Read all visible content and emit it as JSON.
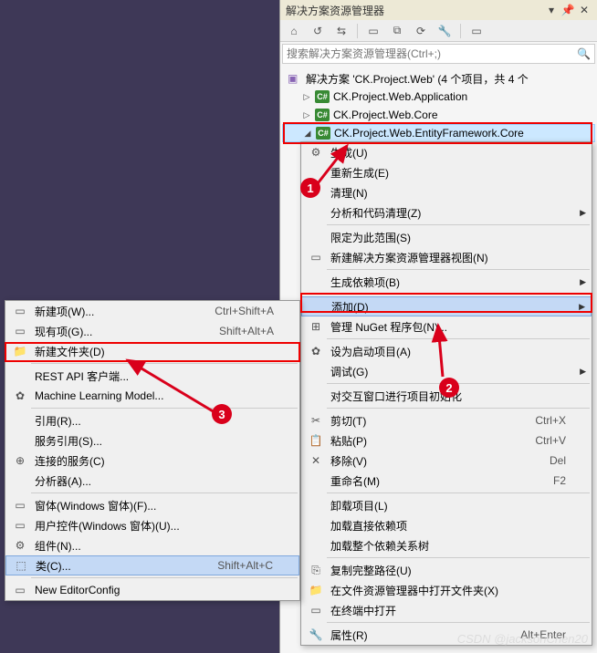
{
  "panel": {
    "title": "解决方案资源管理器",
    "search_placeholder": "搜索解决方案资源管理器(Ctrl+;)"
  },
  "tree": {
    "solution": "解决方案 'CK.Project.Web' (4 个项目，共 4 个",
    "p1": "CK.Project.Web.Application",
    "p2": "CK.Project.Web.Core",
    "p3": "CK.Project.Web.EntityFramework.Core"
  },
  "rmenu": {
    "build": "生成(U)",
    "rebuild": "重新生成(E)",
    "clean": "清理(N)",
    "analyze": "分析和代码清理(Z)",
    "scope": "限定为此范围(S)",
    "newview": "新建解决方案资源管理器视图(N)",
    "builddep": "生成依赖项(B)",
    "add": "添加(D)",
    "nuget": "管理 NuGet 程序包(N)...",
    "startup": "设为启动项目(A)",
    "debug": "调试(G)",
    "interactive": "对交互窗口进行项目初始化",
    "cut": "剪切(T)",
    "paste": "粘贴(P)",
    "remove": "移除(V)",
    "rename": "重命名(M)",
    "unload": "卸载项目(L)",
    "loaddep": "加载直接依赖项",
    "loadtree": "加载整个依赖关系树",
    "copypath": "复制完整路径(U)",
    "openfolder": "在文件资源管理器中打开文件夹(X)",
    "openterm": "在终端中打开",
    "props": "属性(R)",
    "cut_sc": "Ctrl+X",
    "paste_sc": "Ctrl+V",
    "remove_sc": "Del",
    "rename_sc": "F2",
    "props_sc": "Alt+Enter"
  },
  "lmenu": {
    "newitem": "新建项(W)...",
    "existitem": "现有项(G)...",
    "newfolder": "新建文件夹(D)",
    "rest": "REST API 客户端...",
    "ml": "Machine Learning Model...",
    "ref": "引用(R)...",
    "svcref": "服务引用(S)...",
    "connsvc": "连接的服务(C)",
    "analyzer": "分析器(A)...",
    "form": "窗体(Windows 窗体)(F)...",
    "userctl": "用户控件(Windows 窗体)(U)...",
    "component": "组件(N)...",
    "class": "类(C)...",
    "editorconfig": "New EditorConfig",
    "newitem_sc": "Ctrl+Shift+A",
    "existitem_sc": "Shift+Alt+A",
    "class_sc": "Shift+Alt+C"
  },
  "badges": {
    "n1": "1",
    "n2": "2",
    "n3": "3"
  },
  "watermark": "CSDN @jacksonChen20"
}
